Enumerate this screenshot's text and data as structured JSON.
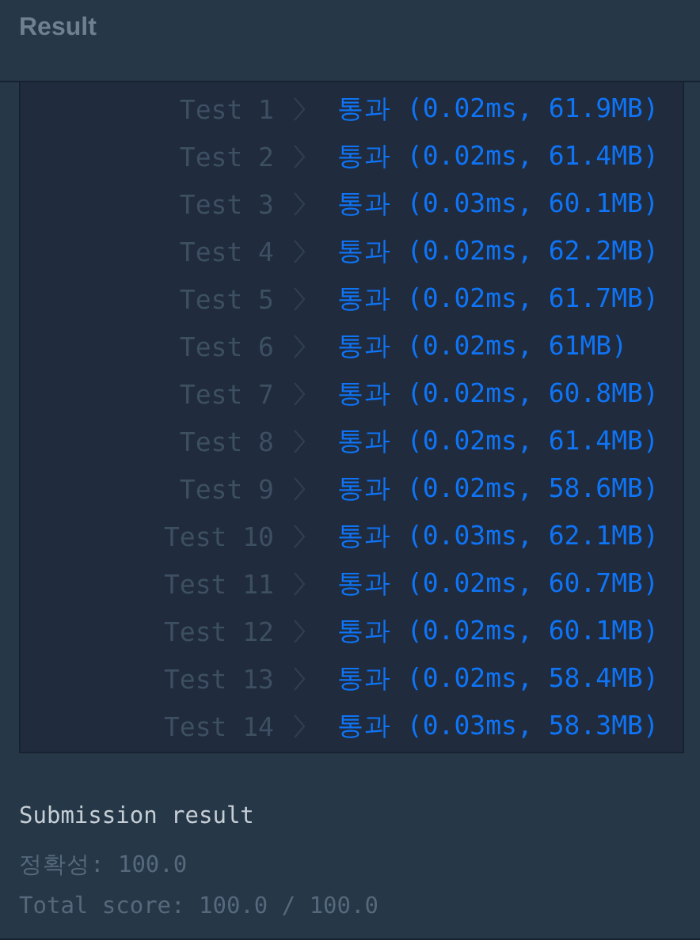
{
  "header": {
    "title": "Result"
  },
  "tests": [
    {
      "label": "Test 1",
      "result": "통과 (0.02ms, 61.9MB)"
    },
    {
      "label": "Test 2",
      "result": "통과 (0.02ms, 61.4MB)"
    },
    {
      "label": "Test 3",
      "result": "통과 (0.03ms, 60.1MB)"
    },
    {
      "label": "Test 4",
      "result": "통과 (0.02ms, 62.2MB)"
    },
    {
      "label": "Test 5",
      "result": "통과 (0.02ms, 61.7MB)"
    },
    {
      "label": "Test 6",
      "result": "통과 (0.02ms, 61MB)"
    },
    {
      "label": "Test 7",
      "result": "통과 (0.02ms, 60.8MB)"
    },
    {
      "label": "Test 8",
      "result": "통과 (0.02ms, 61.4MB)"
    },
    {
      "label": "Test 9",
      "result": "통과 (0.02ms, 58.6MB)"
    },
    {
      "label": "Test 10",
      "result": "통과 (0.03ms, 62.1MB)"
    },
    {
      "label": "Test 11",
      "result": "통과 (0.02ms, 60.7MB)"
    },
    {
      "label": "Test 12",
      "result": "통과 (0.02ms, 60.1MB)"
    },
    {
      "label": "Test 13",
      "result": "통과 (0.02ms, 58.4MB)"
    },
    {
      "label": "Test 14",
      "result": "통과 (0.03ms, 58.3MB)"
    }
  ],
  "summary": {
    "title": "Submission result",
    "lines": [
      "정확성: 100.0",
      "Total score: 100.0 / 100.0"
    ]
  }
}
